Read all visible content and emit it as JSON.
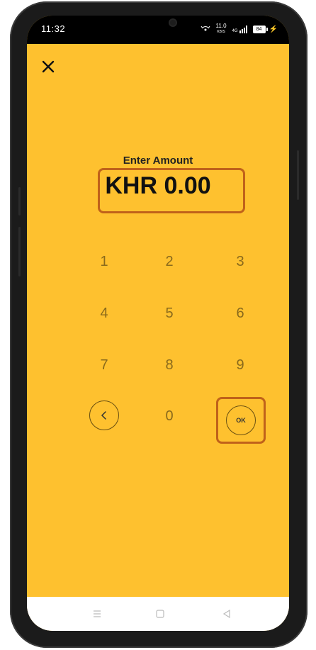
{
  "status_bar": {
    "time": "11:32",
    "speed_value": "11.0",
    "speed_unit": "KB/S",
    "network": "4G",
    "battery": "84"
  },
  "header": {
    "close_icon": "close-icon"
  },
  "amount": {
    "label": "Enter Amount",
    "value": "KHR 0.00"
  },
  "keypad": {
    "keys": [
      "1",
      "2",
      "3",
      "4",
      "5",
      "6",
      "7",
      "8",
      "9",
      "0"
    ],
    "back_icon": "chevron-left-icon",
    "ok_label": "OK"
  },
  "nav_bar": {
    "icons": [
      "menu-icon",
      "home-icon",
      "back-icon"
    ]
  },
  "colors": {
    "background": "#FEC12F",
    "highlight": "#C0621A",
    "key_text": "#8a6a1c"
  }
}
